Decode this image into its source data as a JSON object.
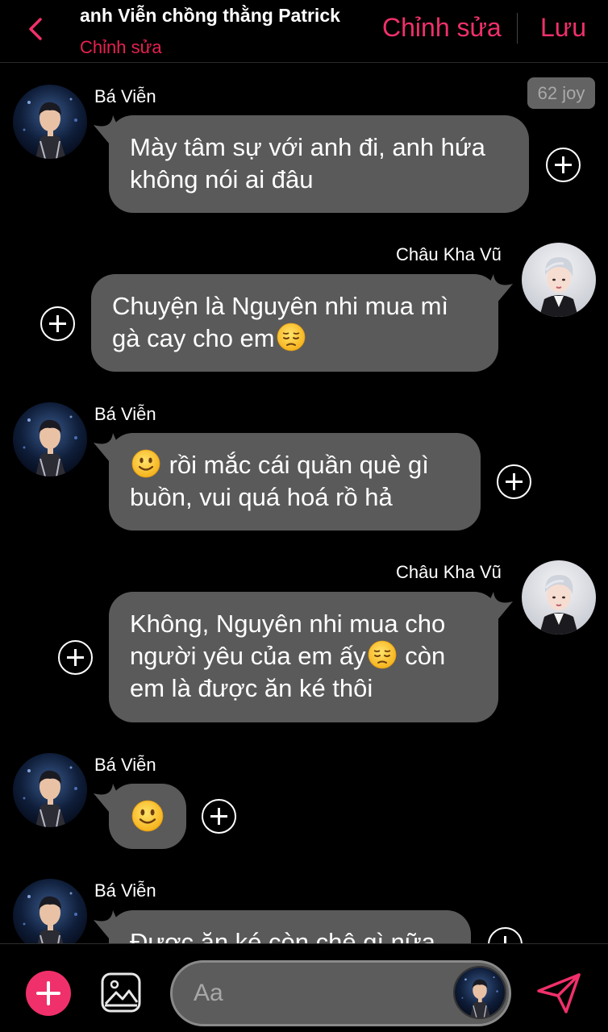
{
  "header": {
    "title": "anh Viễn chồng thằng Patrick",
    "subtitle": "Chỉnh sửa",
    "edit_label": "Chỉnh sửa",
    "save_label": "Lưu"
  },
  "badge": "62 joy",
  "messages": [
    {
      "sender": "Bá Viễn",
      "text_1": "Mày tâm sự với anh đi, anh hứa\nkhông nói ai đâu"
    },
    {
      "sender": "Châu Kha Vũ",
      "text_1": "Chuyện là Nguyên nhi mua mì\ngà cay cho em"
    },
    {
      "sender": "Bá Viễn",
      "text_1": " rồi mắc cái quần què gì\nbuồn, vui quá hoá rồ hả"
    },
    {
      "sender": "Châu Kha Vũ",
      "text_1": "Không, Nguyên nhi mua cho\nngười yêu của em ấy",
      "text_2": " còn\nem là được ăn ké thôi"
    },
    {
      "sender": "Bá Viễn",
      "text_1": ""
    },
    {
      "sender": "Bá Viễn",
      "text_1": "Được ăn ké còn chê gì nữa"
    }
  ],
  "composer": {
    "placeholder": "Aa"
  },
  "icons": {
    "back": "chevron-left-icon",
    "add": "plus-icon",
    "image": "image-icon",
    "send": "send-icon",
    "pensive": "pensive-face-emoji",
    "smile": "slightly-smiling-face-emoji"
  },
  "colors": {
    "accent": "#f0306a",
    "bubble": "#5a5a5a",
    "background": "#000000"
  }
}
